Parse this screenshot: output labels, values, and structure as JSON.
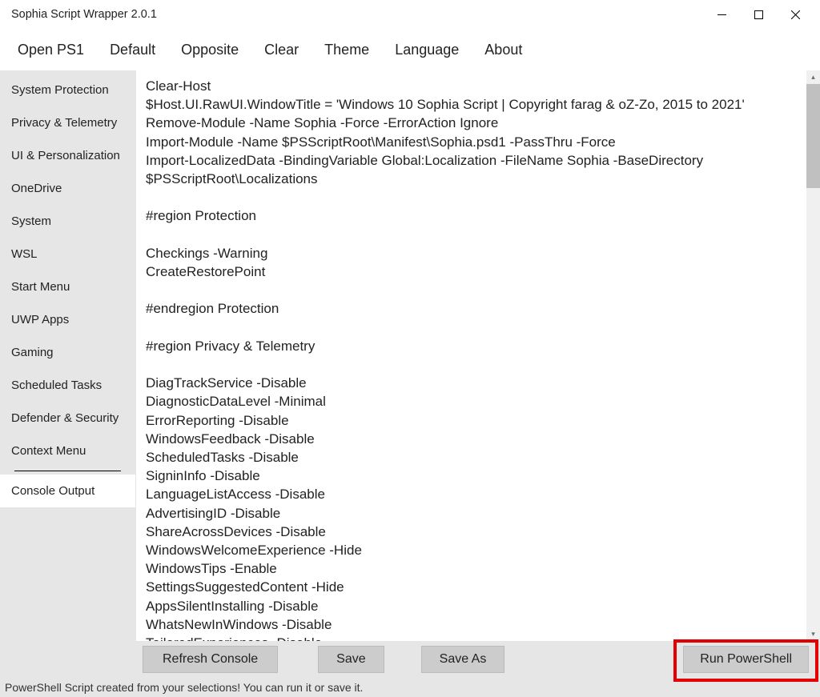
{
  "window": {
    "title": "Sophia Script Wrapper 2.0.1"
  },
  "menu": {
    "open_ps1": "Open PS1",
    "default": "Default",
    "opposite": "Opposite",
    "clear": "Clear",
    "theme": "Theme",
    "language": "Language",
    "about": "About"
  },
  "sidebar": {
    "items": [
      "System Protection",
      "Privacy & Telemetry",
      "UI & Personalization",
      "OneDrive",
      "System",
      "WSL",
      "Start Menu",
      "UWP Apps",
      "Gaming",
      "Scheduled Tasks",
      "Defender & Security",
      "Context Menu"
    ],
    "selected": "Console Output"
  },
  "console": {
    "text": "Clear-Host\n$Host.UI.RawUI.WindowTitle = 'Windows 10 Sophia Script | Copyright farag & oZ-Zo, 2015 to 2021'\nRemove-Module -Name Sophia -Force -ErrorAction Ignore\nImport-Module -Name $PSScriptRoot\\Manifest\\Sophia.psd1 -PassThru -Force\nImport-LocalizedData -BindingVariable Global:Localization -FileName Sophia -BaseDirectory $PSScriptRoot\\Localizations\n\n#region Protection\n\nCheckings -Warning\nCreateRestorePoint\n\n#endregion Protection\n\n#region Privacy & Telemetry\n\nDiagTrackService -Disable\nDiagnosticDataLevel -Minimal\nErrorReporting -Disable\nWindowsFeedback -Disable\nScheduledTasks -Disable\nSigninInfo -Disable\nLanguageListAccess -Disable\nAdvertisingID -Disable\nShareAcrossDevices -Disable\nWindowsWelcomeExperience -Hide\nWindowsTips -Enable\nSettingsSuggestedContent -Hide\nAppsSilentInstalling -Disable\nWhatsNewInWindows -Disable\nTailoredExperiences -Disable"
  },
  "buttons": {
    "refresh": "Refresh Console",
    "save": "Save",
    "save_as": "Save As",
    "run": "Run PowerShell"
  },
  "status": {
    "text": "PowerShell Script created from your selections! You can run it or save it."
  }
}
